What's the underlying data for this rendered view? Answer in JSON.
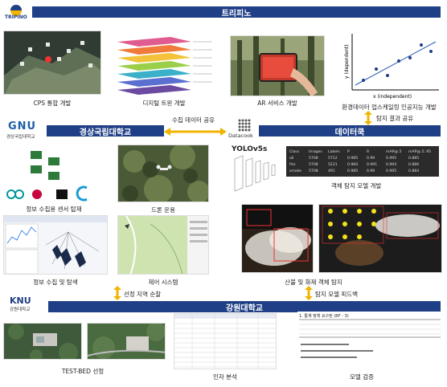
{
  "orgs": {
    "tripino": {
      "logo_text": "TRIPINO",
      "banner": "트리피노"
    },
    "gnu": {
      "logo_text": "GNU",
      "logo_sub": "경상국립대학교",
      "banner": "경상국립대학교"
    },
    "datacook": {
      "logo_text": "Datacook",
      "banner": "데이터쿡"
    },
    "knu": {
      "logo_text": "KNU",
      "logo_sub": "강원대학교",
      "banner": "강원대학교"
    }
  },
  "tripino_items": [
    {
      "caption": "CPS 통합 개발"
    },
    {
      "caption": "디지털 트윈 개발"
    },
    {
      "caption": "AR 서비스 개발"
    },
    {
      "caption": "환경데이터 업스케일링 인공지능 개발"
    }
  ],
  "gnu_items": [
    {
      "caption": "정보 수집용 센서 탑재"
    },
    {
      "caption": "드론 운용"
    },
    {
      "caption": "정보 수집 및 탐색"
    },
    {
      "caption": "제어 시스템"
    }
  ],
  "datacook_items": [
    {
      "caption": "객체 탐지 모델 개발"
    },
    {
      "caption": "산불 및 화재 객체 탐지"
    }
  ],
  "knu_items": [
    {
      "caption": "TEST-BED 선정"
    },
    {
      "caption": "인자 분석"
    },
    {
      "caption": "모델 검증"
    }
  ],
  "flows": {
    "share_data": "수집 데이터 공유",
    "share_result": "탐지 결과 공유",
    "select_area": "선정 지역 순찰",
    "feedback": "탐지 모델 피드백"
  },
  "decor": {
    "yolo": "YOLOv5s",
    "regression_x": "x (independent)",
    "regression_y": "y (dependent)",
    "table_title": "1. 통계 정책 요구된 (RF - 3)",
    "yolo_table_header": [
      "Class",
      "Images",
      "Labels",
      "P",
      "R",
      "mAP@.5",
      "mAP@.5:.95"
    ],
    "yolo_table_rows": [
      [
        "all",
        "5708",
        "5712",
        "0.985",
        "0.99",
        "0.995",
        "0.885"
      ],
      [
        "fire",
        "5708",
        "5221",
        "0.984",
        "0.991",
        "0.994",
        "0.886"
      ],
      [
        "smoke",
        "5708",
        "491",
        "0.985",
        "0.99",
        "0.995",
        "0.884"
      ]
    ]
  }
}
